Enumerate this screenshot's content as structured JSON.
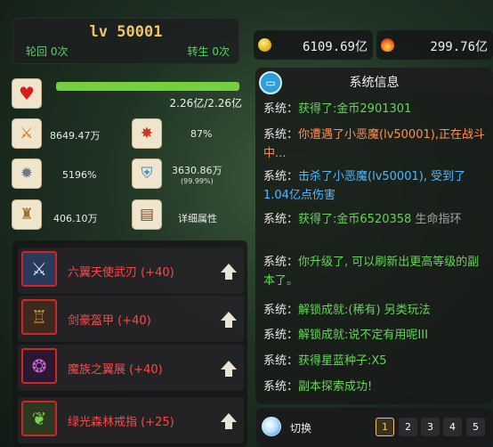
{
  "player": {
    "level": "lv 50001",
    "rebirth": "轮回 0次",
    "reincarnation": "转生 0次"
  },
  "currency": {
    "gold": "6109.69亿",
    "power": "299.76亿"
  },
  "hp": {
    "text": "2.26亿/2.26亿",
    "fraction": 1.0
  },
  "stats": {
    "attack": "8649.47万",
    "crit": "87%",
    "crit_damage": "5196%",
    "defense": "3630.86万",
    "defense_pct": "(99.99%)",
    "speed": "406.10万",
    "details": "详细属性"
  },
  "equipment": [
    {
      "name": "六翼天使武刃 (+40)",
      "icon": "wings-sword-icon"
    },
    {
      "name": "剑豪盔甲 (+40)",
      "icon": "armor-icon"
    },
    {
      "name": "魔族之翼展 (+40)",
      "icon": "demon-wing-icon"
    },
    {
      "name": "绿光森林戒指 (+25)",
      "icon": "ring-icon"
    }
  ],
  "system": {
    "title": "系统信息",
    "messages": [
      {
        "who": "系统：",
        "parts": [
          {
            "text": "获得了:金币2901301",
            "c": "t"
          }
        ]
      },
      {
        "who": "系统：",
        "parts": [
          {
            "text": "你遭遇了小恶魔(lv50001),正在战斗中...",
            "c": "red"
          }
        ]
      },
      {
        "who": "系统：",
        "parts": [
          {
            "text": "击杀了小恶魔(lv50001), 受到了1.04亿点伤害",
            "c": "blue"
          }
        ]
      },
      {
        "who": "系统：",
        "parts": [
          {
            "text": "获得了:金币6520358 ",
            "c": "t"
          },
          {
            "text": "生命指环",
            "c": "gray"
          }
        ]
      },
      {
        "who": "系统：",
        "parts": [
          {
            "text": "你升级了, 可以刷新出更高等级的副本了。",
            "c": "t"
          }
        ]
      },
      {
        "who": "系统：",
        "parts": [
          {
            "text": "解锁成就:(稀有) 另类玩法",
            "c": "t"
          }
        ]
      },
      {
        "who": "系统：",
        "parts": [
          {
            "text": "解锁成就:说不定有用呢III",
            "c": "t"
          }
        ]
      },
      {
        "who": "系统：",
        "parts": [
          {
            "text": "获得星蓝种子:X5",
            "c": "t"
          }
        ]
      },
      {
        "who": "系统：",
        "parts": [
          {
            "text": "副本探索成功!",
            "c": "t"
          }
        ]
      }
    ]
  },
  "bottom": {
    "switch_label": "切换",
    "pages": [
      "1",
      "2",
      "3",
      "4",
      "5"
    ],
    "active_page": "1"
  }
}
